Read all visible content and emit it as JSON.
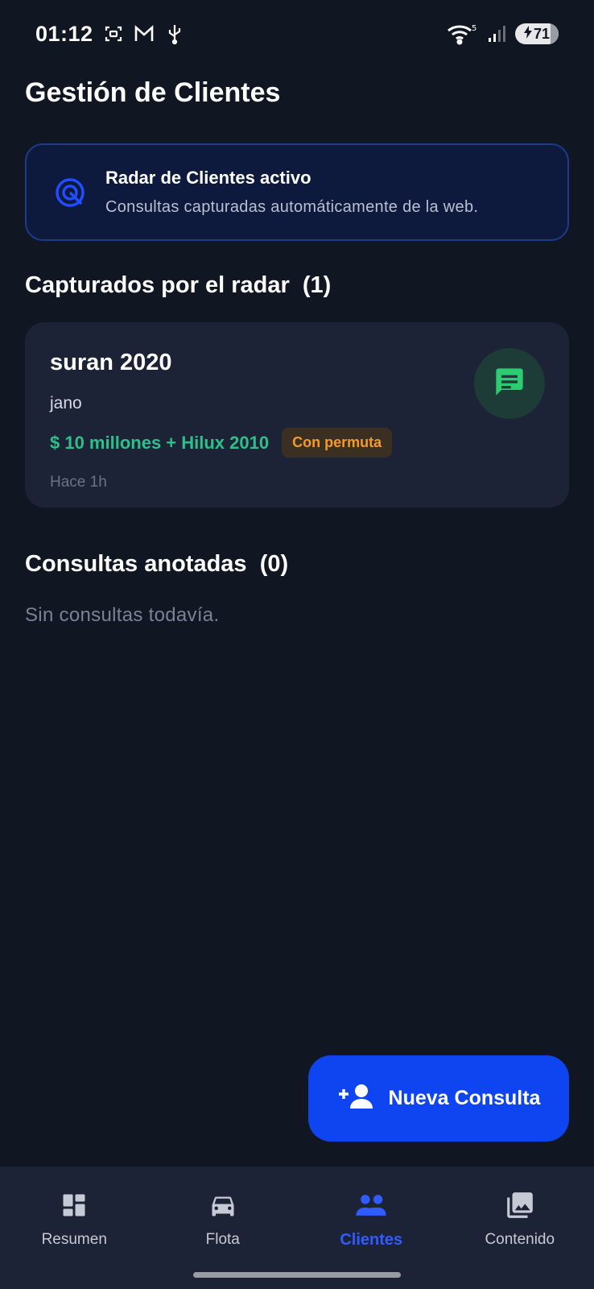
{
  "status_bar": {
    "time": "01:12",
    "network_label": "5",
    "battery": "71"
  },
  "page": {
    "title": "Gestión de Clientes"
  },
  "radar_banner": {
    "title": "Radar de Clientes activo",
    "subtitle": "Consultas capturadas automáticamente de la web."
  },
  "captured_section": {
    "title": "Capturados por el radar",
    "count": "(1)"
  },
  "leads": [
    {
      "title": "suran 2020",
      "name": "jano",
      "price": "$ 10 millones + Hilux 2010",
      "badge": "Con permuta",
      "time": "Hace 1h"
    }
  ],
  "notes_section": {
    "title": "Consultas anotadas",
    "count": "(0)",
    "empty_text": "Sin consultas todavía."
  },
  "fab": {
    "label": "Nueva Consulta"
  },
  "bottom_nav": {
    "items": [
      {
        "label": "Resumen",
        "icon": "dashboard-icon"
      },
      {
        "label": "Flota",
        "icon": "car-icon"
      },
      {
        "label": "Clientes",
        "icon": "people-icon"
      },
      {
        "label": "Contenido",
        "icon": "photo-library-icon"
      }
    ],
    "active_index": 2
  },
  "colors": {
    "background": "#111623",
    "card": "#1d2337",
    "accent": "#0f45f0",
    "price_green": "#2fc08a",
    "badge_orange": "#f59a2a",
    "chat_green": "#2ecc71"
  }
}
